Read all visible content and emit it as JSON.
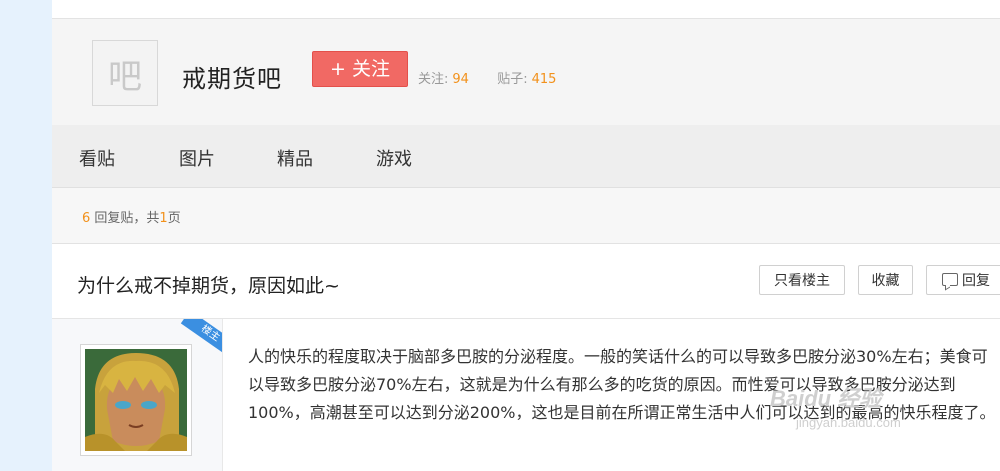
{
  "forum": {
    "logo_char": "吧",
    "name": "戒期货吧",
    "follow_label": "+ 关注",
    "follow_count_label": "关注:",
    "follow_count": "94",
    "post_count_label": "贴子:",
    "post_count": "415"
  },
  "nav": {
    "tabs": [
      "看贴",
      "图片",
      "精品",
      "游戏"
    ]
  },
  "reply_info": {
    "count": "6",
    "text_mid": " 回复贴，共",
    "pages": "1",
    "text_end": "页"
  },
  "thread": {
    "title": "为什么戒不掉期货，原因如此~",
    "only_op_label": "只看楼主",
    "collect_label": "收藏",
    "reply_label": "回复"
  },
  "post": {
    "op_tag": "楼主",
    "content": "人的快乐的程度取决于脑部多巴胺的分泌程度。一般的笑话什么的可以导致多巴胺分泌30%左右；美食可以导致多巴胺分泌70%左右，这就是为什么有那么多的吃货的原因。而性爱可以导致多巴胺分泌达到100%，高潮甚至可以达到分泌200%，这也是目前在所谓正常生活中人们可以达到的最高的快乐程度了。",
    "avatar_icon": "anime-character-avatar"
  },
  "watermark": {
    "line1": "Baidu 经验",
    "line2": "jingyan.baidu.com"
  },
  "colors": {
    "accent_orange": "#f2911b",
    "follow_red": "#f16964",
    "op_tag_blue": "#3b8fe1",
    "left_strip": "#e6f2fd"
  }
}
